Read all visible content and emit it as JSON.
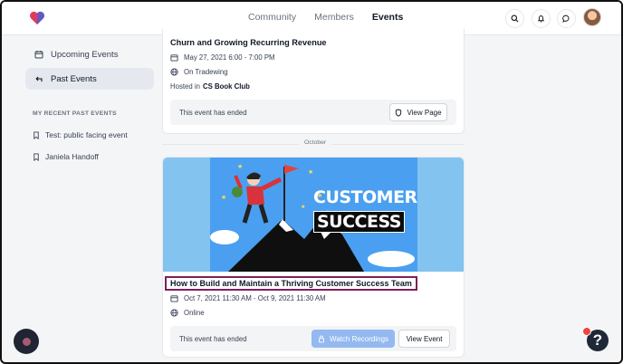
{
  "header": {
    "nav": [
      "Community",
      "Members",
      "Events"
    ],
    "active_nav": "Events",
    "icons": [
      "search-icon",
      "bell-icon",
      "chat-icon"
    ]
  },
  "sidebar": {
    "items": [
      {
        "label": "Upcoming Events",
        "icon": "calendar-icon"
      },
      {
        "label": "Past Events",
        "icon": "return-icon",
        "active": true
      }
    ],
    "recent_heading": "MY RECENT PAST EVENTS",
    "recent": [
      "Test: public facing event",
      "Janiela Handoff"
    ]
  },
  "event1": {
    "title": "Churn and Growing Recurring Revenue",
    "date": "May 27, 2021 6:00 - 7:00 PM",
    "location": "On Tradewing",
    "hosted_prefix": "Hosted in",
    "hosted_club": "CS Book Club",
    "status": "This event has ended",
    "button": "View Page"
  },
  "month_label": "October",
  "event2": {
    "banner_word1": "CUSTOMER",
    "banner_word2": "SUCCESS",
    "title": "How to Build and Maintain a Thriving Customer Success Team",
    "date": "Oct 7, 2021 11:30 AM - Oct 9, 2021 11:30 AM",
    "location": "Online",
    "status": "This event has ended",
    "recordings_button": "Watch Recordings",
    "view_button": "View Event"
  },
  "help": {
    "label": "?",
    "badge_color": "#ef4444"
  },
  "colors": {
    "accent": "#93b9f0",
    "highlight_border": "#7d1f5c",
    "banner_bg": "#4a9ff0"
  }
}
